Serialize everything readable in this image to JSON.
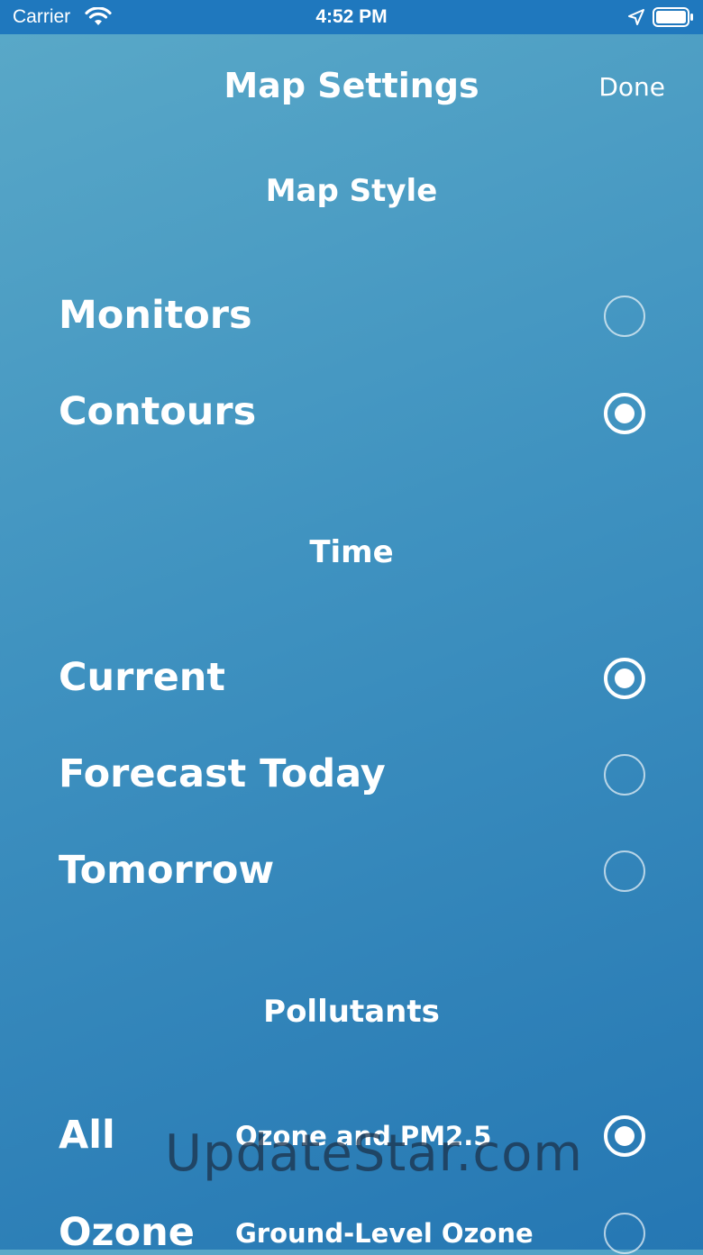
{
  "status_bar": {
    "carrier": "Carrier",
    "time": "4:52 PM",
    "icons": [
      "wifi-icon",
      "location-arrow-icon",
      "battery-icon"
    ]
  },
  "nav": {
    "title": "Map Settings",
    "done_label": "Done"
  },
  "sections": {
    "map_style": {
      "header": "Map Style",
      "options": [
        {
          "label": "Monitors",
          "selected": false
        },
        {
          "label": "Contours",
          "selected": true
        }
      ]
    },
    "time": {
      "header": "Time",
      "options": [
        {
          "label": "Current",
          "selected": true
        },
        {
          "label": "Forecast Today",
          "selected": false
        },
        {
          "label": "Tomorrow",
          "selected": false
        }
      ]
    },
    "pollutants": {
      "header": "Pollutants",
      "options": [
        {
          "label": "All",
          "sublabel": "Ozone and PM2.5",
          "selected": true
        },
        {
          "label": "Ozone",
          "sublabel": "Ground-Level Ozone",
          "selected": false
        }
      ]
    }
  },
  "watermark": "UpdateStar.com",
  "colors": {
    "status_bar_bg": "#1f78be",
    "background_top": "#5aa9c8",
    "background_bottom": "#2577b3",
    "text": "#ffffff"
  }
}
